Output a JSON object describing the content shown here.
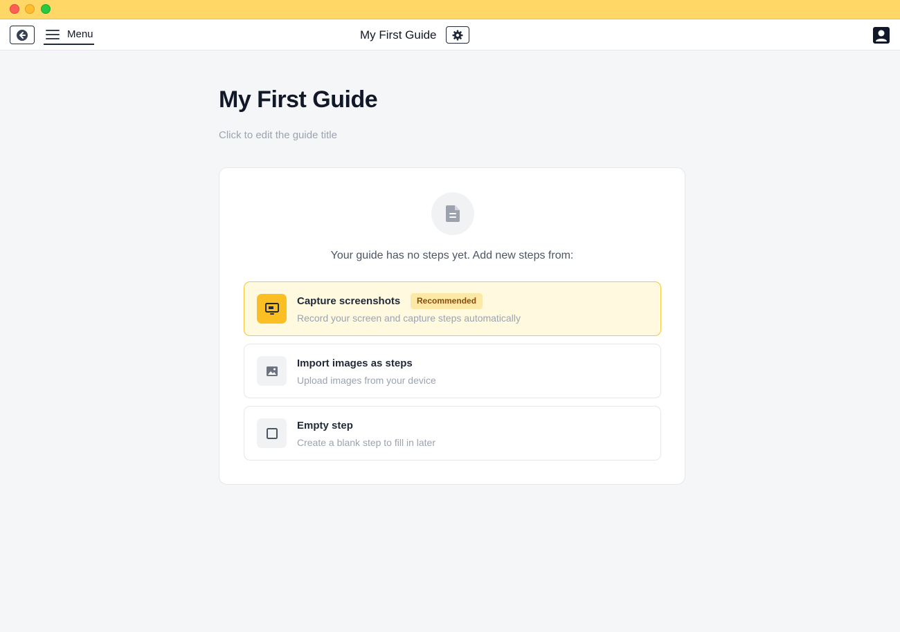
{
  "window": {
    "controls": [
      "close",
      "minimize",
      "zoom"
    ]
  },
  "toolbar": {
    "back_icon": "arrow-left-circle-icon",
    "menu_icon": "hamburger-icon",
    "menu_label": "Menu",
    "doc_title": "My First Guide",
    "settings_icon": "gear-icon",
    "account_icon": "user-account-icon"
  },
  "main": {
    "heading": "My First Guide",
    "title_hint": "Click to edit the guide title"
  },
  "card": {
    "empty_icon": "document-icon",
    "empty_text": "Your guide has no steps yet. Add new steps from:",
    "options": [
      {
        "icon": "screen-capture-icon",
        "title": "Capture screenshots",
        "badge": "Recommended",
        "description": "Record your screen and capture steps automatically"
      },
      {
        "icon": "image-icon",
        "title": "Import images as steps",
        "description": "Upload images from your device"
      },
      {
        "icon": "empty-square-icon",
        "title": "Empty step",
        "description": "Create a blank step to fill in later"
      }
    ]
  },
  "colors": {
    "titlebar": "#ffd766",
    "accent": "#fbbf24",
    "highlight_bg": "#fff9e0",
    "badge_bg": "#fde9a7",
    "badge_text": "#8a4b08"
  }
}
